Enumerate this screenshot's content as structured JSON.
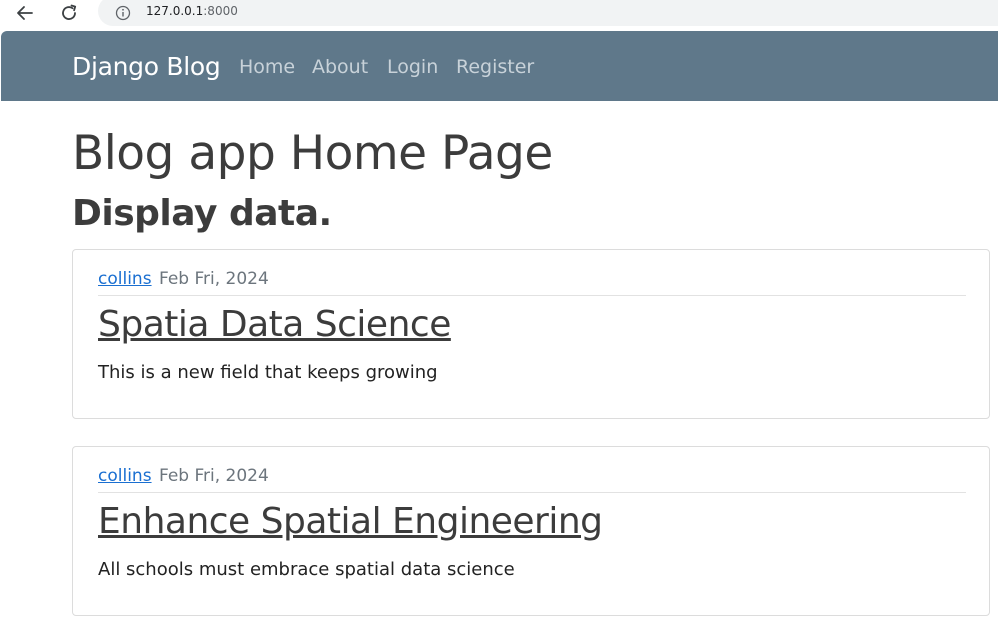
{
  "browser": {
    "url_host": "127.0.0.1",
    "url_port": ":8000"
  },
  "navbar": {
    "brand": "Django Blog",
    "links": [
      "Home",
      "About",
      "Login",
      "Register"
    ]
  },
  "main": {
    "heading": "Blog app Home Page",
    "subheading": "Display data."
  },
  "posts": [
    {
      "author": "collins",
      "date": "Feb Fri, 2024",
      "title": "Spatia Data Science",
      "content": "This is a new field that keeps growing"
    },
    {
      "author": "collins",
      "date": "Feb Fri, 2024",
      "title": "Enhance Spatial Engineering",
      "content": "All schools must embrace spatial data science"
    }
  ],
  "colors": {
    "navbar_bg": "#5f788a",
    "link_blue": "#1a6fd1",
    "text_dark": "#3c3c3c"
  }
}
